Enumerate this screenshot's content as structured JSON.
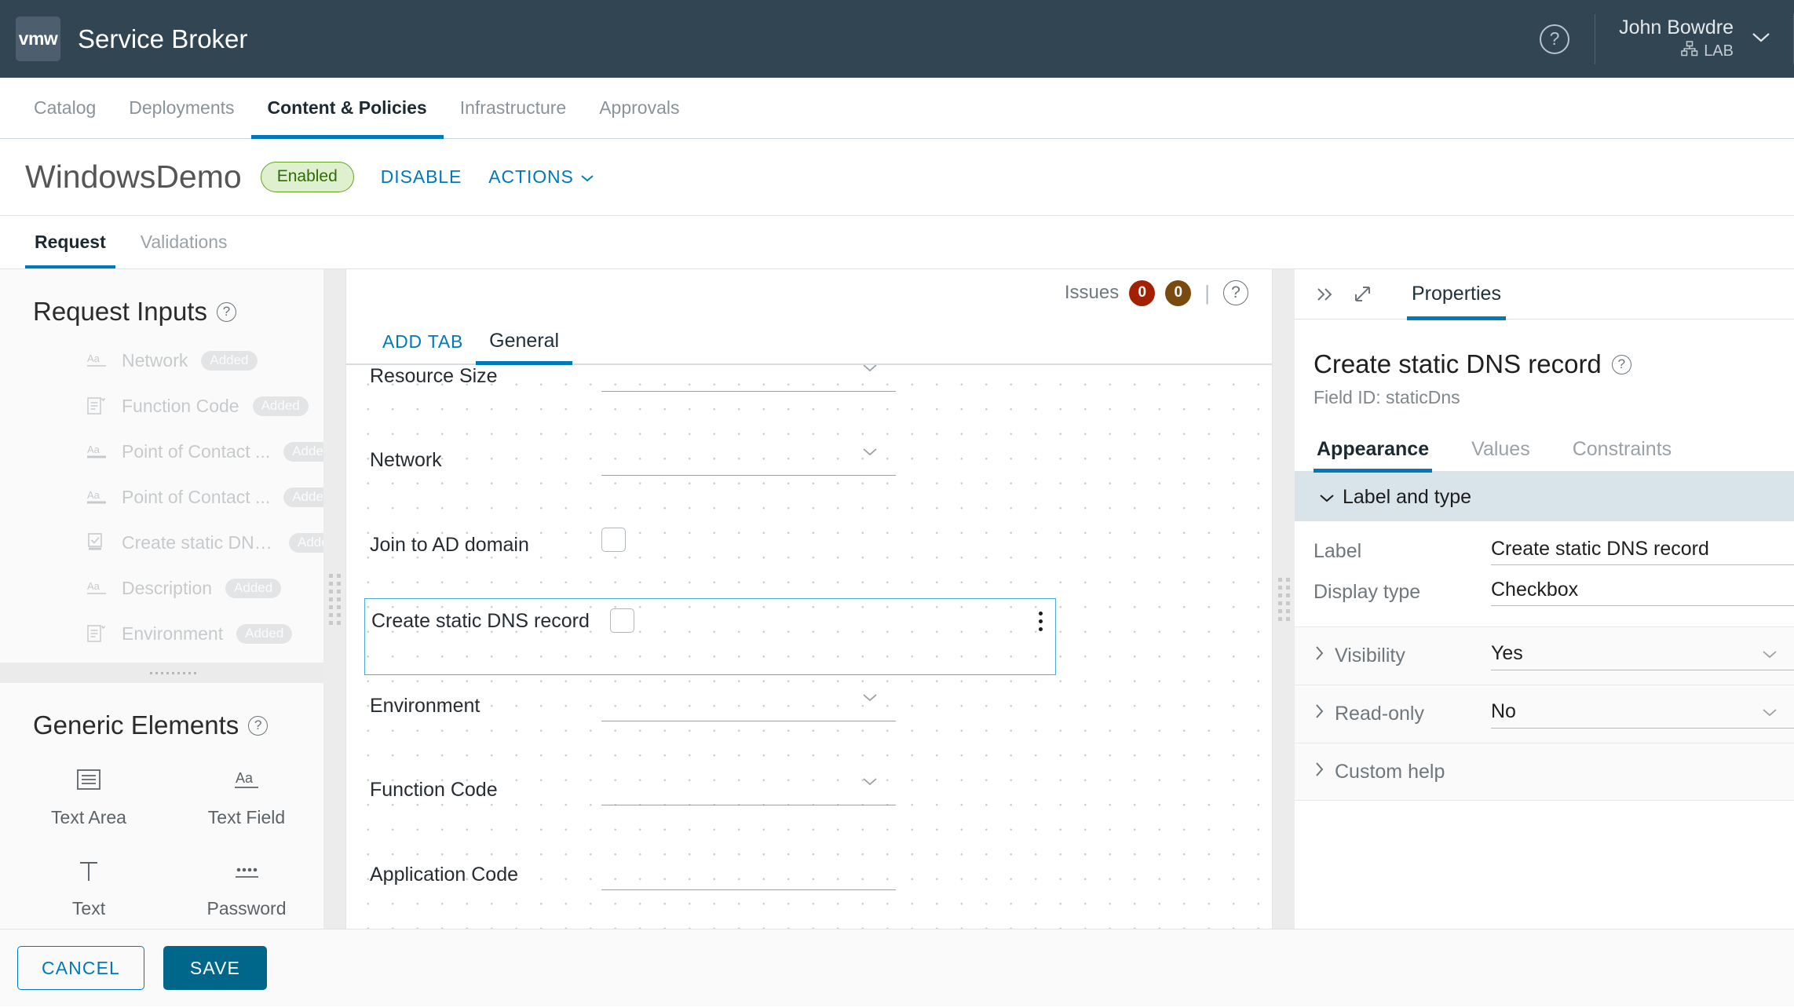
{
  "header": {
    "logo_text": "vmw",
    "app_title": "Service Broker",
    "help_icon": "help-circle-icon",
    "user_name": "John Bowdre",
    "user_org": "LAB",
    "org_icon": "org-tree-icon",
    "chevron": "chevron-down-icon"
  },
  "nav": {
    "tabs": [
      {
        "label": "Catalog",
        "active": false
      },
      {
        "label": "Deployments",
        "active": false
      },
      {
        "label": "Content & Policies",
        "active": true
      },
      {
        "label": "Infrastructure",
        "active": false
      },
      {
        "label": "Approvals",
        "active": false
      }
    ]
  },
  "page": {
    "title": "WindowsDemo",
    "status_badge": "Enabled",
    "disable_label": "DISABLE",
    "actions_label": "ACTIONS",
    "subtabs": [
      {
        "label": "Request",
        "active": true
      },
      {
        "label": "Validations",
        "active": false
      }
    ]
  },
  "left_panel": {
    "request_inputs_title": "Request Inputs",
    "inputs": [
      {
        "icon": "text-field-icon",
        "label": "Network",
        "badge": "Added"
      },
      {
        "icon": "dropdown-icon",
        "label": "Function Code",
        "badge": "Added"
      },
      {
        "icon": "text-field-icon",
        "label": "Point of Contact ...",
        "badge": "Added"
      },
      {
        "icon": "text-field-icon",
        "label": "Point of Contact ...",
        "badge": "Added"
      },
      {
        "icon": "checkbox-icon",
        "label": "Create static DNS...",
        "badge": "Added"
      },
      {
        "icon": "text-field-icon",
        "label": "Description",
        "badge": "Added"
      },
      {
        "icon": "dropdown-icon",
        "label": "Environment",
        "badge": "Added"
      }
    ],
    "generic_elements_title": "Generic Elements",
    "generic_elements": [
      {
        "icon": "text-area-icon",
        "label": "Text Area"
      },
      {
        "icon": "text-field-icon",
        "label": "Text Field"
      },
      {
        "icon": "text-icon",
        "label": "Text"
      },
      {
        "icon": "password-icon",
        "label": "Password"
      }
    ]
  },
  "canvas": {
    "issues_label": "Issues",
    "issues_error_count": "0",
    "issues_warning_count": "0",
    "issues_error_color": "#a32100",
    "issues_warning_color": "#7a4a0e",
    "help_icon": "help-circle-icon",
    "add_tab_label": "ADD TAB",
    "tabs": [
      {
        "label": "General",
        "active": true
      }
    ],
    "fields": [
      {
        "label": "Resource Size",
        "type": "dropdown",
        "selected": false
      },
      {
        "label": "Network",
        "type": "dropdown",
        "selected": false
      },
      {
        "label": "Join to AD domain",
        "type": "checkbox",
        "selected": false
      },
      {
        "label": "Create static DNS record",
        "type": "checkbox",
        "selected": true
      },
      {
        "label": "Environment",
        "type": "dropdown",
        "selected": false
      },
      {
        "label": "Function Code",
        "type": "dropdown",
        "selected": false
      },
      {
        "label": "Application Code",
        "type": "dropdown",
        "selected": false
      }
    ]
  },
  "right_panel": {
    "collapse_icon": "chevrons-right-icon",
    "expand_icon": "expand-diagonal-icon",
    "tab_label": "Properties",
    "field_title": "Create static DNS record",
    "field_id_text": "Field ID: staticDns",
    "subtabs": [
      {
        "label": "Appearance",
        "active": true
      },
      {
        "label": "Values",
        "active": false
      },
      {
        "label": "Constraints",
        "active": false
      }
    ],
    "accordion_label_and_type": "Label and type",
    "label_key": "Label",
    "label_value": "Create static DNS record",
    "display_type_key": "Display type",
    "display_type_value": "Checkbox",
    "sections": [
      {
        "key": "Visibility",
        "value": "Yes",
        "has_value": true
      },
      {
        "key": "Read-only",
        "value": "No",
        "has_value": true
      },
      {
        "key": "Custom help",
        "value": "",
        "has_value": false
      }
    ]
  },
  "footer": {
    "cancel_label": "CANCEL",
    "save_label": "SAVE"
  },
  "colors": {
    "accent": "#0079b8",
    "header_bg": "#324553",
    "primary_button": "#00678a",
    "selection_outline": "#49afd9"
  }
}
